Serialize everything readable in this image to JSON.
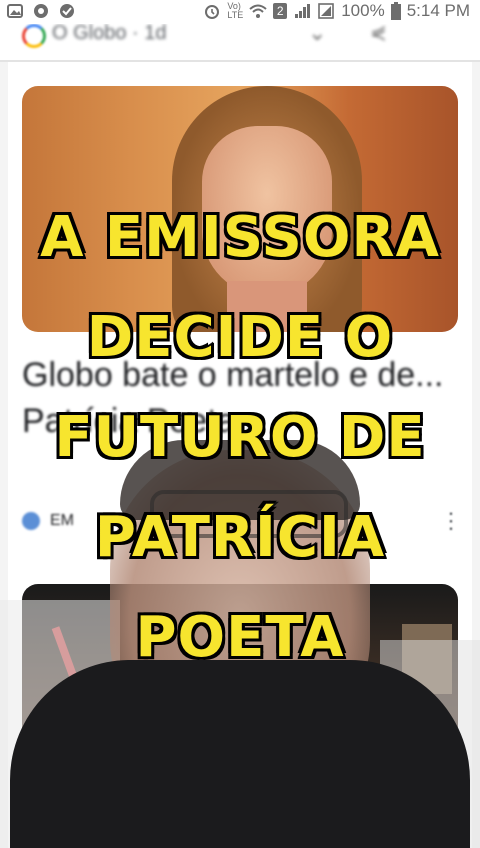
{
  "status_bar": {
    "battery_percent": "100%",
    "time": "5:14 PM",
    "network_label": "Vo)\nLTE",
    "sim_badge": "2"
  },
  "feed": {
    "header_source": "O Globo · 1d",
    "article_title": "Globo bate o martelo e de... Patrícia Poeta...",
    "source_name": "EM",
    "more_icon": "more-vert-icon"
  },
  "headline": {
    "lines": [
      "A EMISSORA",
      "DECIDE O",
      "FUTURO DE",
      "PATRÍCIA",
      "POETA"
    ],
    "text_color": "#f7e52e",
    "outline_color": "#111111"
  }
}
